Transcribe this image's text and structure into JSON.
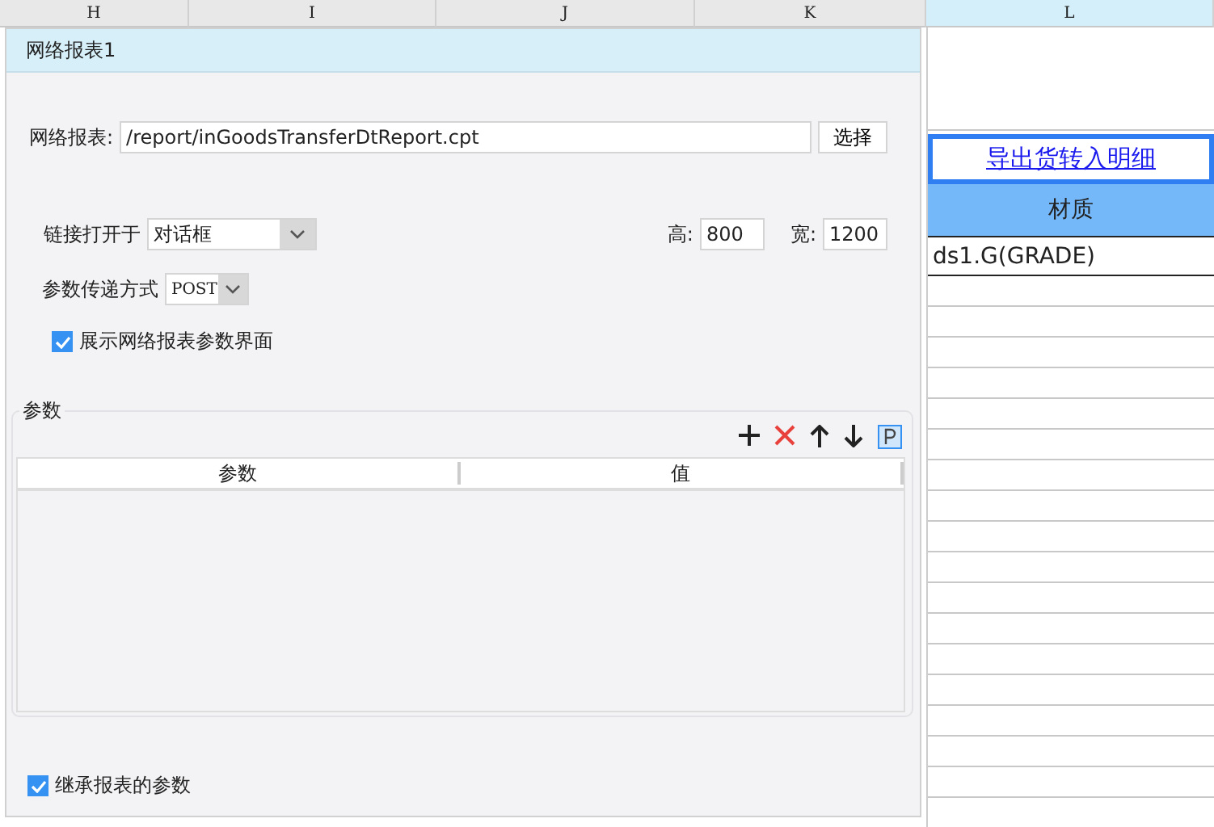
{
  "columns": [
    {
      "label": "H",
      "selected": false
    },
    {
      "label": "I",
      "selected": false
    },
    {
      "label": "J",
      "selected": false
    },
    {
      "label": "K",
      "selected": false
    },
    {
      "label": "L",
      "selected": true
    }
  ],
  "dialog": {
    "title": "网络报表1",
    "report": {
      "label": "网络报表:",
      "value": "/report/inGoodsTransferDtReport.cpt",
      "button": "选择"
    },
    "open_in": {
      "label": "链接打开于",
      "value": "对话框"
    },
    "height": {
      "label": "高:",
      "value": "800"
    },
    "width": {
      "label": "宽:",
      "value": "1200"
    },
    "method": {
      "label": "参数传递方式",
      "value": "POST"
    },
    "show_params": {
      "label": "展示网络报表参数界面",
      "checked": true
    },
    "params": {
      "title": "参数",
      "columns": [
        "参数",
        "值"
      ]
    },
    "inherit": {
      "label": "继承报表的参数",
      "checked": true
    }
  },
  "sheet": {
    "link": "导出货转入明细",
    "header": "材质",
    "field": "ds1.G(GRADE)"
  }
}
